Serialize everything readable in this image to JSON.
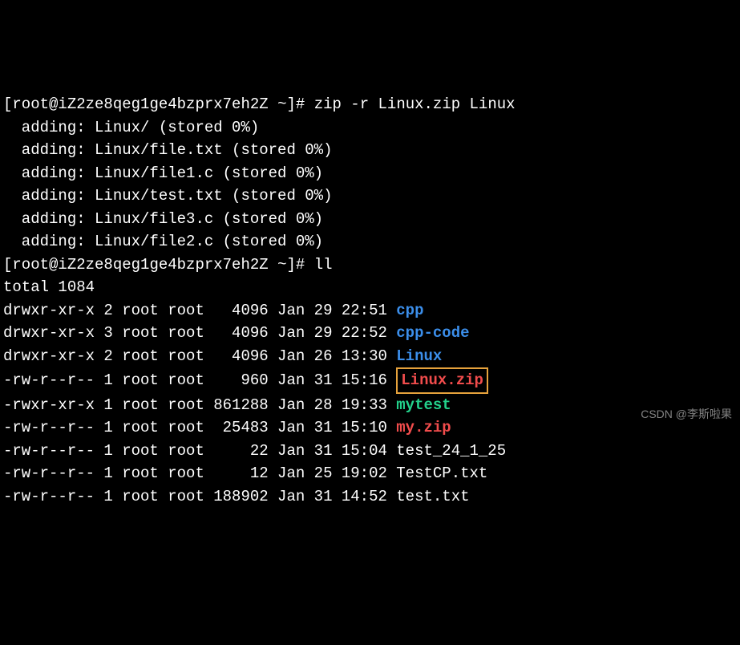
{
  "prompt": {
    "open": "[",
    "user": "root",
    "at": "@",
    "host": "iZ2ze8qeg1ge4bzprx7eh2Z",
    "space": " ",
    "tilde": "~",
    "close": "]",
    "hash": "# "
  },
  "cmd1": "zip -r Linux.zip Linux",
  "adding": [
    "  adding: Linux/ (stored 0%)",
    "  adding: Linux/file.txt (stored 0%)",
    "  adding: Linux/file1.c (stored 0%)",
    "  adding: Linux/test.txt (stored 0%)",
    "  adding: Linux/file3.c (stored 0%)",
    "  adding: Linux/file2.c (stored 0%)"
  ],
  "cmd2": "ll",
  "total": "total 1084",
  "listing": [
    {
      "pre": "drwxr-xr-x 2 root root   4096 Jan 29 22:51 ",
      "name": "cpp",
      "cls": "dir"
    },
    {
      "pre": "drwxr-xr-x 3 root root   4096 Jan 29 22:52 ",
      "name": "cpp-code",
      "cls": "dir"
    },
    {
      "pre": "drwxr-xr-x 2 root root   4096 Jan 26 13:30 ",
      "name": "Linux",
      "cls": "dir"
    },
    {
      "pre": "-rw-r--r-- 1 root root    960 Jan 31 15:16 ",
      "name": "Linux.zip",
      "cls": "zip boxed"
    },
    {
      "pre": "-rwxr-xr-x 1 root root 861288 Jan 28 19:33 ",
      "name": "mytest",
      "cls": "exe"
    },
    {
      "pre": "-rw-r--r-- 1 root root  25483 Jan 31 15:10 ",
      "name": "my.zip",
      "cls": "zip"
    },
    {
      "pre": "-rw-r--r-- 1 root root     22 Jan 31 15:04 ",
      "name": "test_24_1_25",
      "cls": "file"
    },
    {
      "pre": "-rw-r--r-- 1 root root     12 Jan 25 19:02 ",
      "name": "TestCP.txt",
      "cls": "file"
    },
    {
      "pre": "-rw-r--r-- 1 root root 188902 Jan 31 14:52 ",
      "name": "test.txt",
      "cls": "file"
    }
  ],
  "watermark": "CSDN @李斯啦果"
}
